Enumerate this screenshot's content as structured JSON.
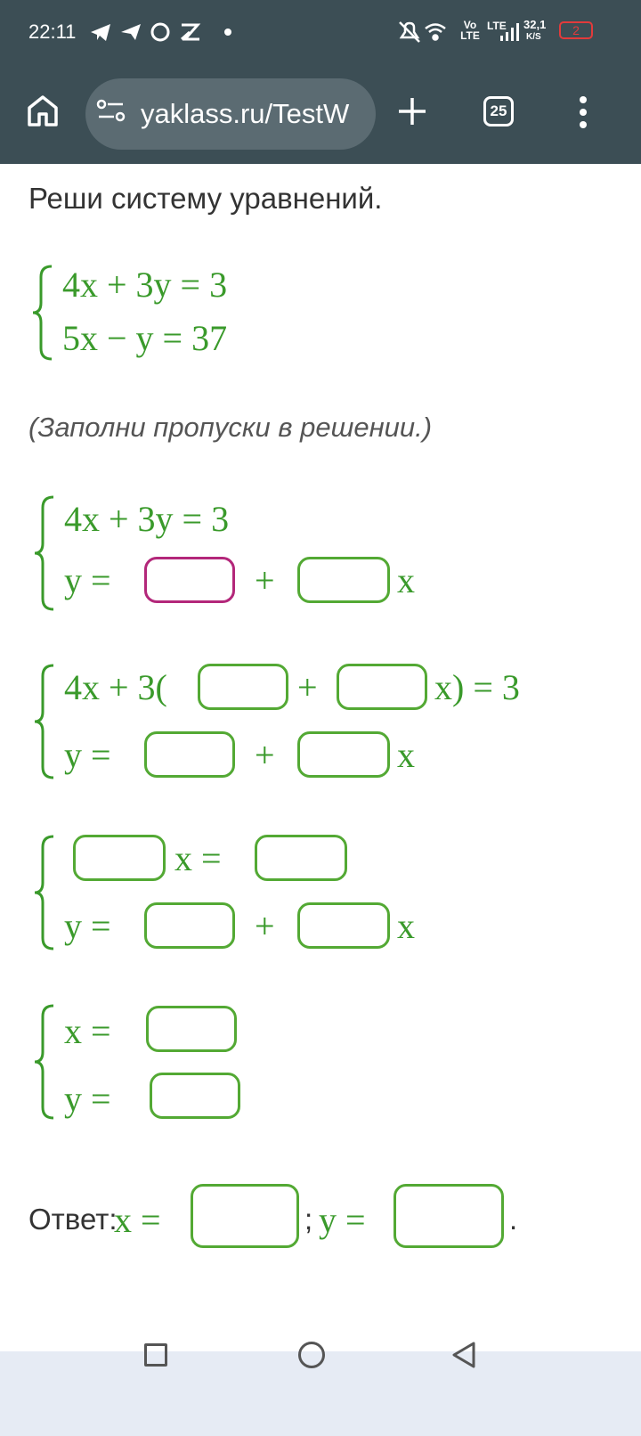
{
  "status_bar": {
    "time": "22:11",
    "network": "Vo LTE",
    "lte": "LTE",
    "speed_value": "32,1",
    "speed_unit": "K/S",
    "battery": "2",
    "icons": [
      "telegram-icon",
      "send-icon",
      "messenger-icon",
      "app-icon",
      "dot-icon",
      "mute-icon",
      "wifi-icon",
      "signal-icon",
      "battery-icon"
    ]
  },
  "browser": {
    "url": "yaklass.ru/TestW",
    "tab_count": "25"
  },
  "task": {
    "question": "Реши систему уравнений.",
    "system": {
      "eq1": "4x + 3y = 3",
      "eq2": "5x − y = 37"
    },
    "hint": "(Заполни пропуски в решении.)",
    "step1": {
      "eq1": "4x + 3y = 3",
      "eq2_y": "y =",
      "plus": "+",
      "x": "x"
    },
    "step2": {
      "eq1_left": "4x + 3(",
      "plus": "+",
      "eq1_right": "x) = 3",
      "eq2_y": "y =",
      "plus2": "+",
      "x": "x"
    },
    "step3": {
      "x_eq": "x =",
      "eq2_y": "y =",
      "plus": "+",
      "x": "x"
    },
    "step4": {
      "x_eq": "x =",
      "y_eq": "y ="
    },
    "answer": {
      "label": "Ответ:",
      "x_eq": "x =",
      "sep": ";",
      "y_eq": "y =",
      "end": "."
    }
  },
  "colors": {
    "math": "#3a9a2b",
    "box_border": "#53a934",
    "active_border": "#b3277a",
    "topbar": "#3c4e55"
  }
}
